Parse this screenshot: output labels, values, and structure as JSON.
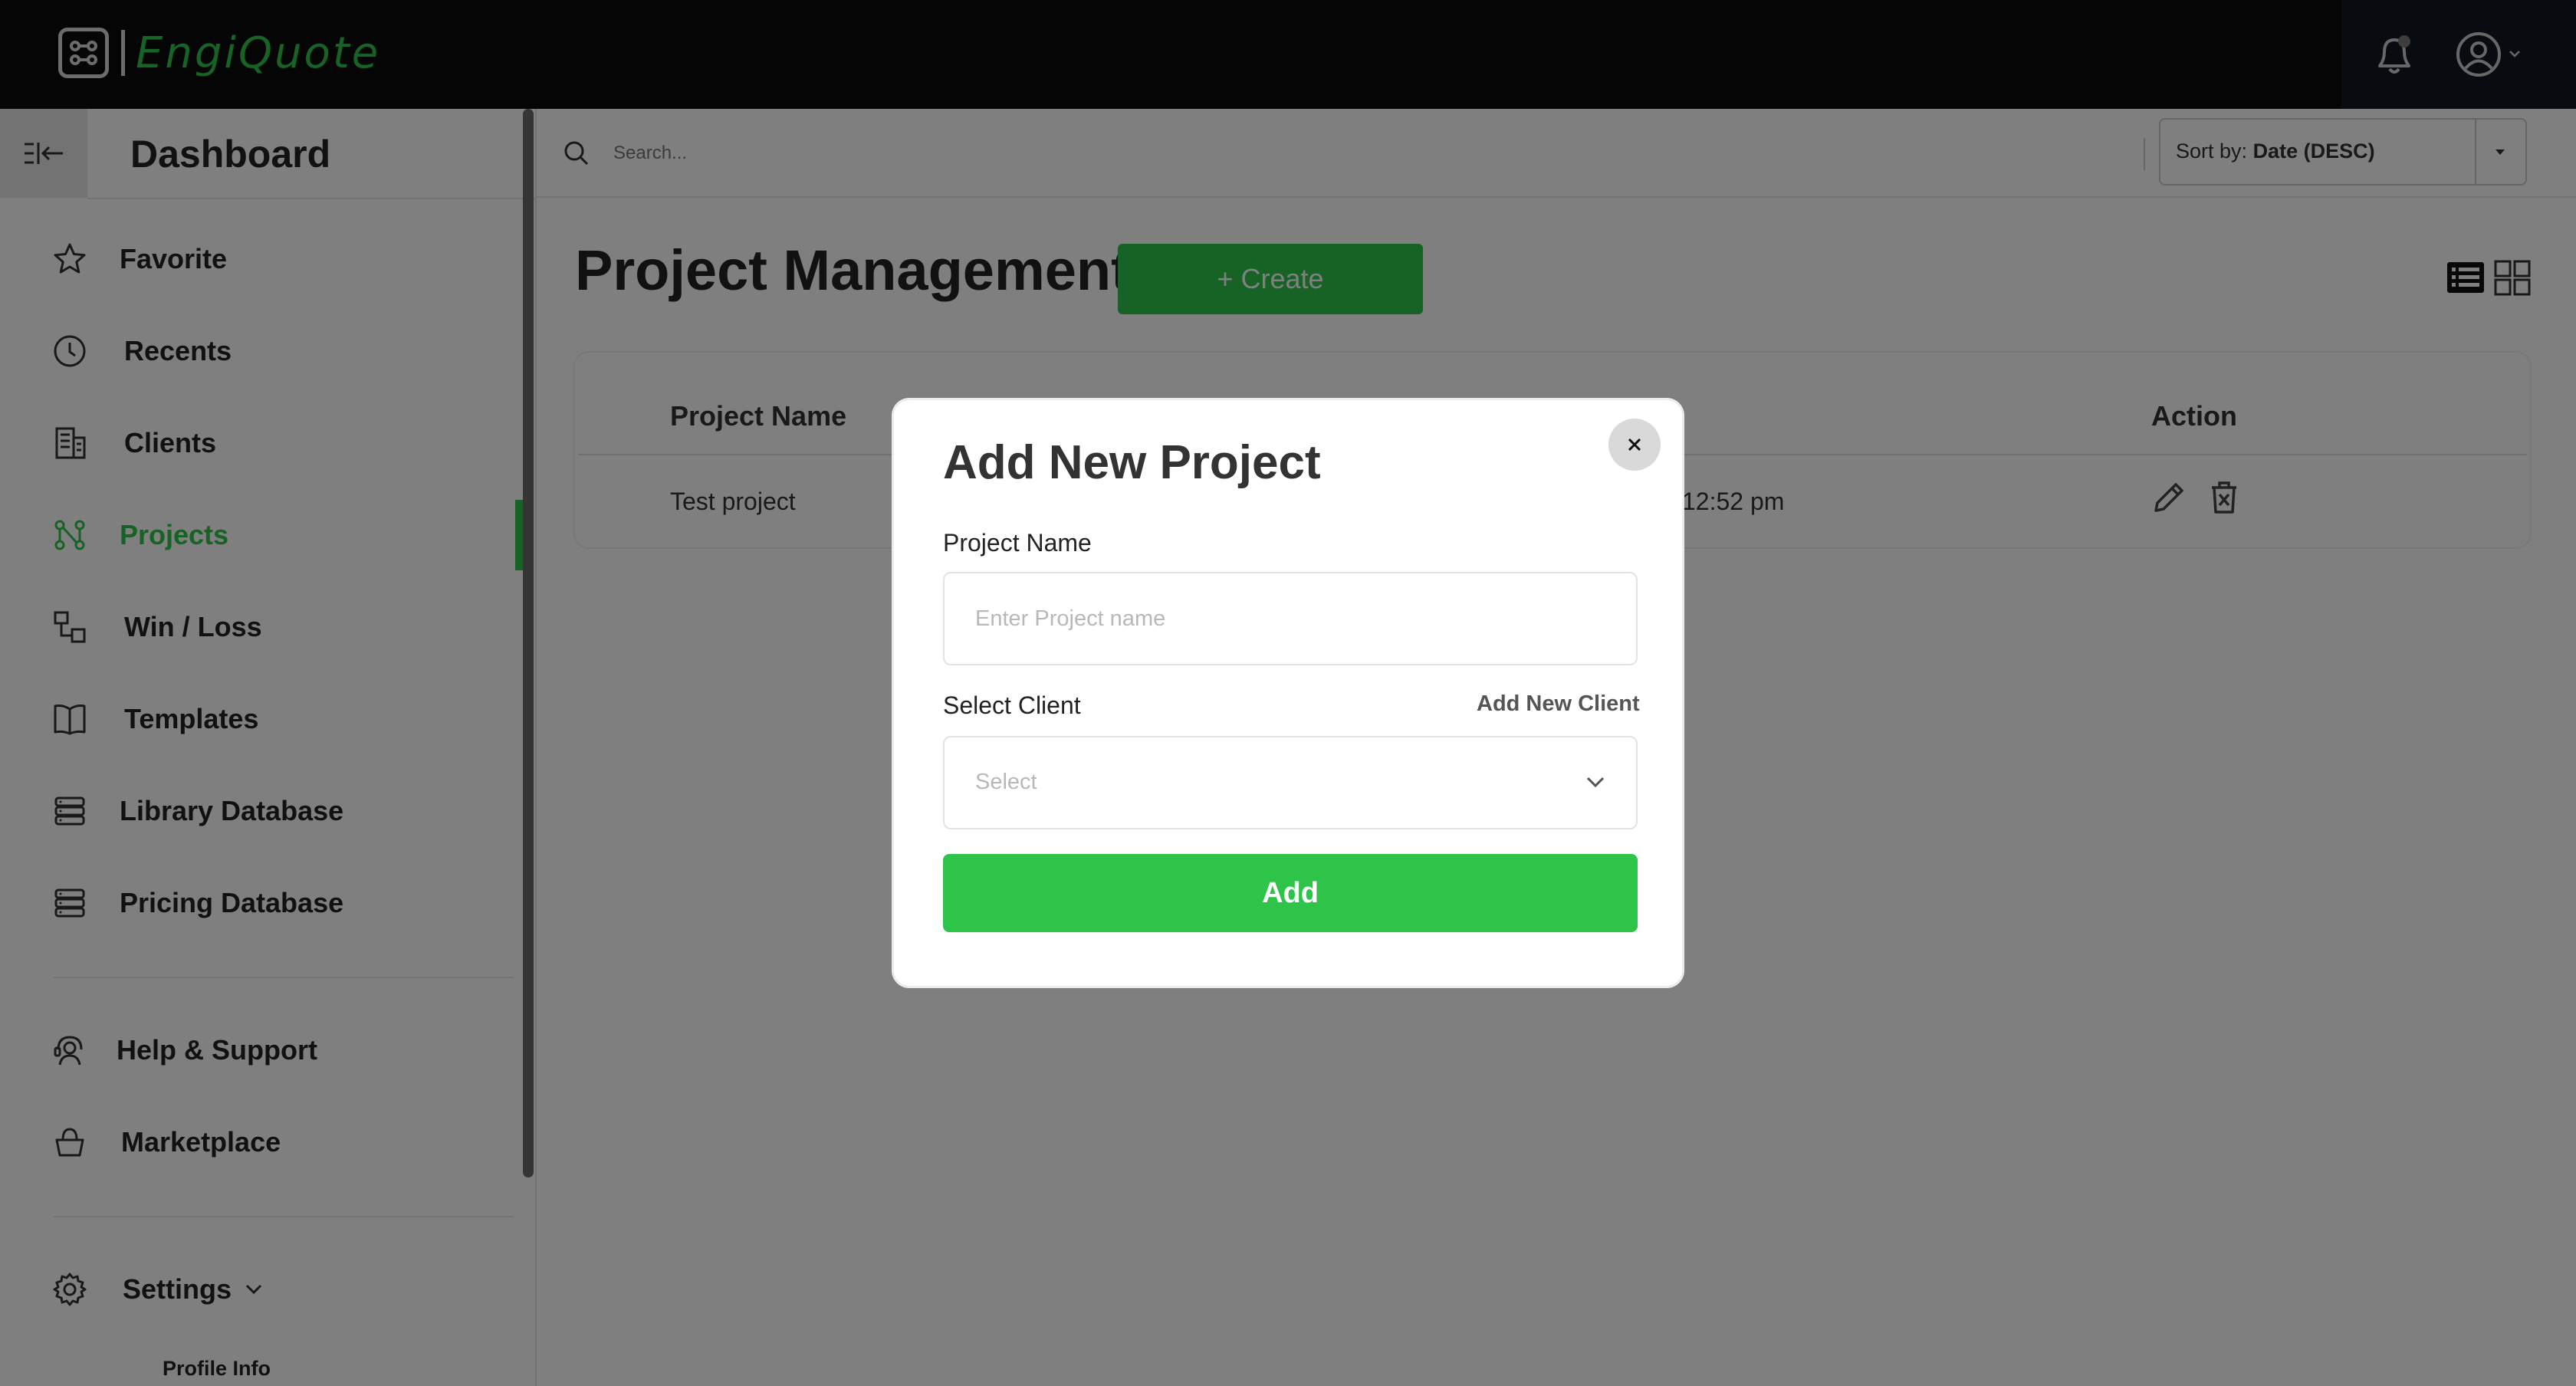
{
  "app": {
    "brand_name": "EngiQuote",
    "brand_color": "#2ec44a"
  },
  "header": {
    "notification_icon": "bell-icon",
    "user_icon": "user-circle-icon"
  },
  "sidebar": {
    "title": "Dashboard",
    "items": [
      {
        "label": "Favorite",
        "icon": "star-icon"
      },
      {
        "label": "Recents",
        "icon": "clock-icon"
      },
      {
        "label": "Clients",
        "icon": "building-icon"
      },
      {
        "label": "Projects",
        "icon": "projects-icon",
        "active": true
      },
      {
        "label": "Win / Loss",
        "icon": "win-loss-icon"
      },
      {
        "label": "Templates",
        "icon": "book-icon"
      },
      {
        "label": "Library Database",
        "icon": "database-icon"
      },
      {
        "label": "Pricing Database",
        "icon": "database-icon"
      },
      {
        "label": "Help & Support",
        "icon": "support-icon"
      },
      {
        "label": "Marketplace",
        "icon": "basket-icon"
      },
      {
        "label": "Settings",
        "icon": "gear-icon"
      }
    ],
    "sub_item": "Profile Info"
  },
  "search": {
    "placeholder": "Search..."
  },
  "sort": {
    "prefix": "Sort by:",
    "value": "Date (DESC)"
  },
  "main": {
    "title": "Project Management",
    "create_label": "+ Create",
    "table": {
      "headers": [
        "Project Name",
        "Action"
      ],
      "rows": [
        {
          "name": "Test project",
          "time": "12:52 pm"
        }
      ]
    }
  },
  "modal": {
    "title": "Add New Project",
    "project_name_label": "Project Name",
    "project_name_placeholder": "Enter Project name",
    "select_client_label": "Select Client",
    "add_new_client_label": "Add New Client",
    "select_placeholder": "Select",
    "add_button_label": "Add"
  }
}
